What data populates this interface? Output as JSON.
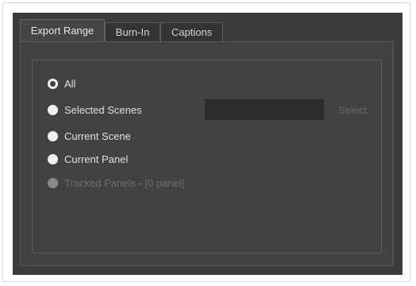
{
  "tabs": [
    {
      "label": "Export Range",
      "active": true
    },
    {
      "label": "Burn-In",
      "active": false
    },
    {
      "label": "Captions",
      "active": false
    }
  ],
  "export_range": {
    "options": [
      {
        "label": "All",
        "checked": true,
        "enabled": true
      },
      {
        "label": "Selected Scenes",
        "checked": false,
        "enabled": true
      },
      {
        "label": "Current Scene",
        "checked": false,
        "enabled": true
      },
      {
        "label": "Current Panel",
        "checked": false,
        "enabled": true
      },
      {
        "label": "Tracked Panels - [0 panel]",
        "checked": false,
        "enabled": false
      }
    ],
    "selected_scenes_value": "",
    "select_button_label": "Select"
  }
}
